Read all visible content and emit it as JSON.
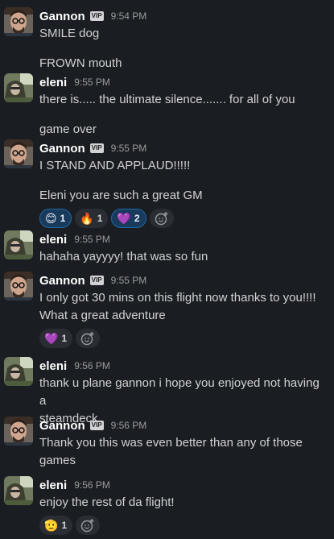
{
  "colors": {
    "background": "#1a1d21",
    "reaction_mine_bg": "#1a3a5c",
    "reaction_mine_border": "#1d6aa8"
  },
  "messages": [
    {
      "sender": "Gannon",
      "vip": "VIP",
      "time": "9:54 PM",
      "lines": [
        "SMILE dog",
        "FROWN mouth"
      ]
    },
    {
      "sender": "eleni",
      "time": "9:55 PM",
      "lines": [
        "there is..... the ultimate silence....... for all of you",
        "game over"
      ]
    },
    {
      "sender": "Gannon",
      "vip": "VIP",
      "time": "9:55 PM",
      "lines": [
        "I STAND AND APPLAUD!!!!!",
        "Eleni you are such a great GM"
      ],
      "reactions": [
        {
          "emoji": "😊",
          "count": "1",
          "icon": "smiling-face-icon"
        },
        {
          "emoji": "🔥",
          "count": "1",
          "icon": "fire-icon"
        },
        {
          "emoji": "💜",
          "count": "2",
          "icon": "purple-heart-icon"
        }
      ]
    },
    {
      "sender": "eleni",
      "time": "9:55 PM",
      "lines": [
        "hahaha yayyyy! that was so fun"
      ]
    },
    {
      "sender": "Gannon",
      "vip": "VIP",
      "time": "9:55 PM",
      "lines": [
        "I only got 30 mins on this flight now thanks to you!!!!",
        "What a great adventure"
      ],
      "reactions": [
        {
          "emoji": "💜",
          "count": "1",
          "icon": "purple-heart-icon"
        }
      ]
    },
    {
      "sender": "eleni",
      "time": "9:56 PM",
      "lines": [
        "thank u plane gannon i hope you enjoyed not having a",
        "steamdeck"
      ]
    },
    {
      "sender": "Gannon",
      "vip": "VIP",
      "time": "9:56 PM",
      "lines": [
        "Thank you this was even better than any of those",
        "games"
      ]
    },
    {
      "sender": "eleni",
      "time": "9:56 PM",
      "lines": [
        "enjoy the rest of da flight!"
      ],
      "reactions": [
        {
          "emoji": "🫡",
          "count": "1",
          "icon": "saluting-face-icon"
        }
      ]
    }
  ]
}
